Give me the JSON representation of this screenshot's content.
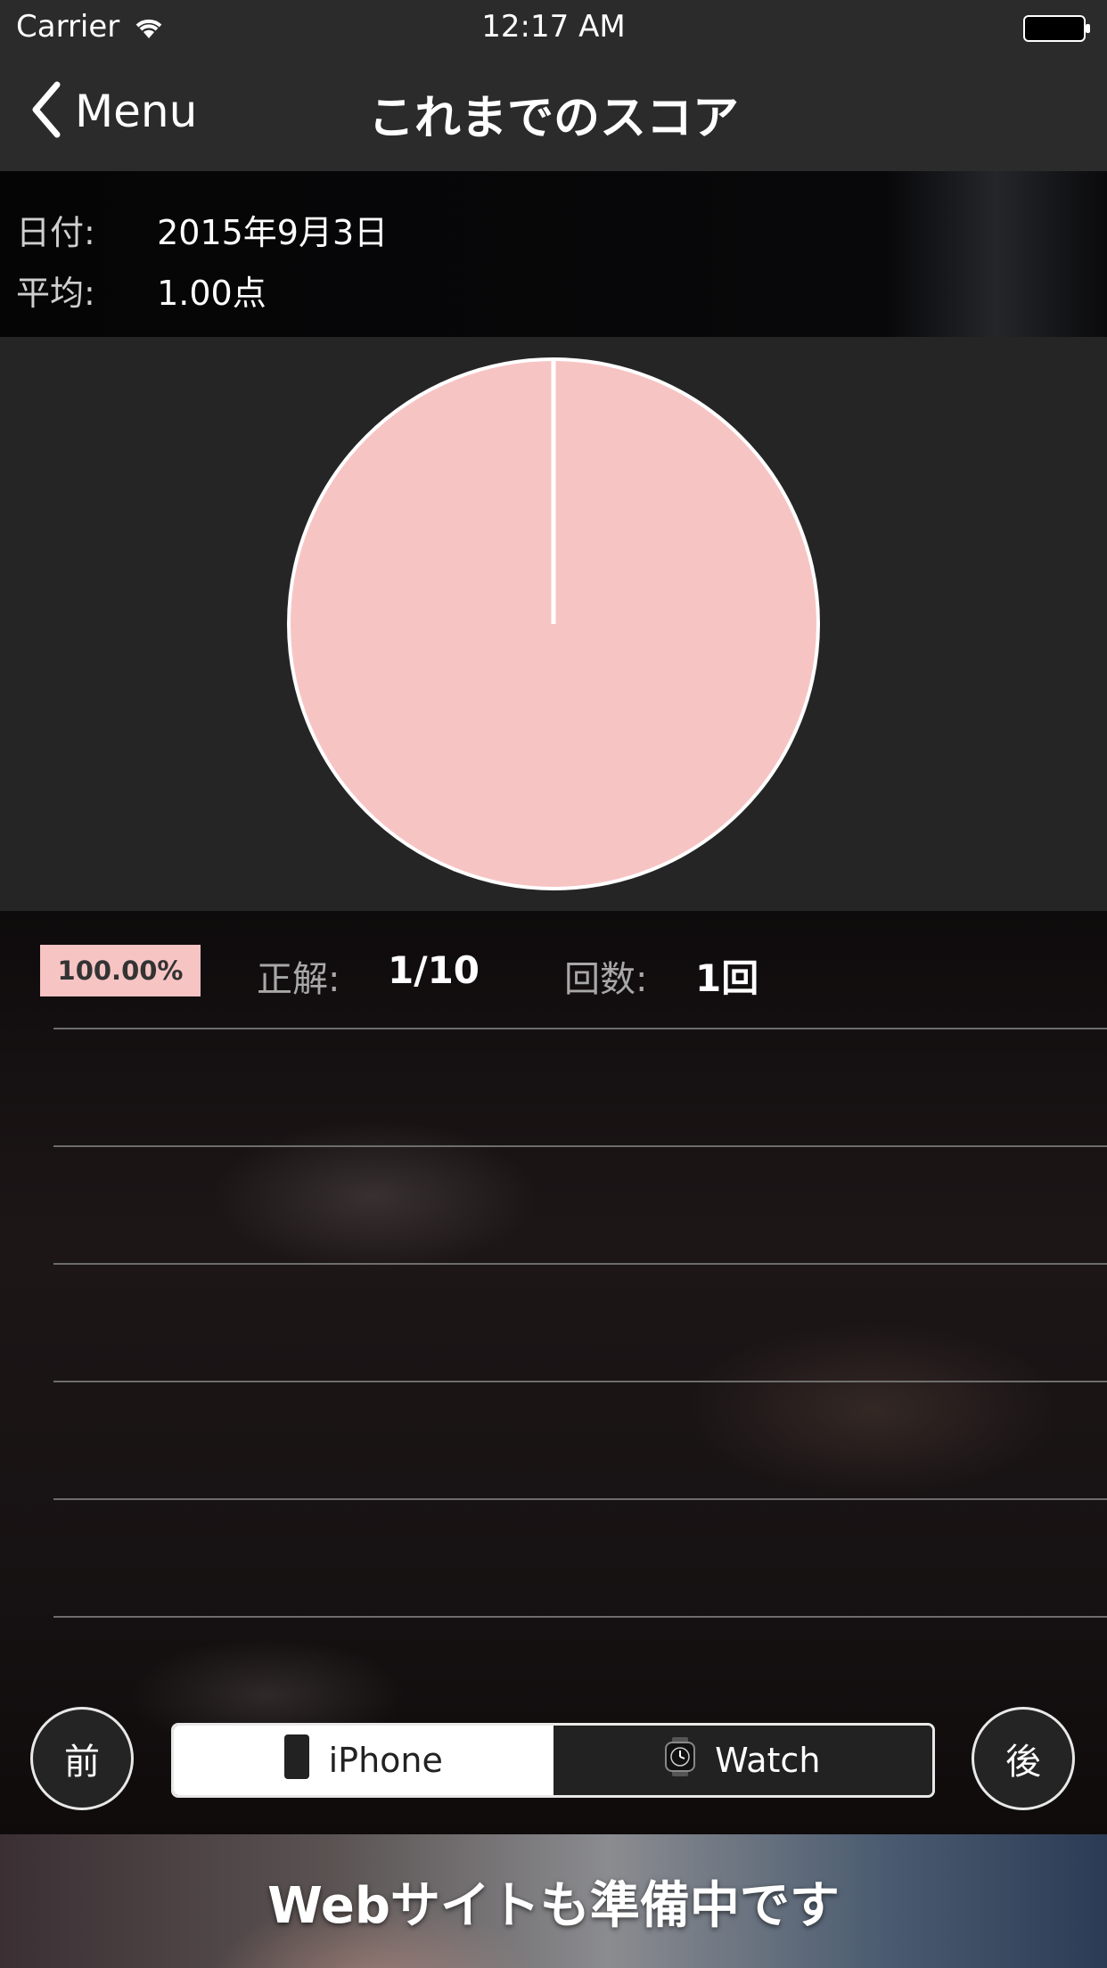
{
  "status_bar": {
    "carrier": "Carrier",
    "time": "12:17 AM"
  },
  "nav": {
    "back_label": "Menu",
    "title": "これまでのスコア"
  },
  "info": {
    "date_label": "日付:",
    "date_value": "2015年9月3日",
    "average_label": "平均:",
    "average_value": "1.00点"
  },
  "chart_data": {
    "type": "pie",
    "values": [
      100
    ],
    "colors": [
      "#f7c4c4"
    ]
  },
  "stats": {
    "percent_badge": "100.00%",
    "correct_label": "正解:",
    "correct_value": "1/10",
    "count_label": "回数:",
    "count_value": "1回"
  },
  "controls": {
    "prev_label": "前",
    "next_label": "後",
    "segments": [
      {
        "label": "iPhone",
        "icon": "iphone-icon",
        "selected": true
      },
      {
        "label": "Watch",
        "icon": "watch-icon",
        "selected": false
      }
    ]
  },
  "banner": {
    "text": "Webサイトも準備中です"
  },
  "colors": {
    "accent_pink": "#f7c4c4",
    "bar": "#2b2b2b"
  }
}
